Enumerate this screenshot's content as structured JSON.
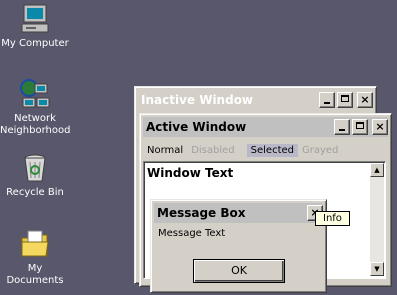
{
  "desktop": {
    "icons": [
      {
        "label": "My Computer"
      },
      {
        "label": "Network Neighborhood"
      },
      {
        "label": "Recycle Bin"
      },
      {
        "label": "My Documents"
      }
    ]
  },
  "inactive_window": {
    "title": "Inactive Window"
  },
  "active_window": {
    "title": "Active Window",
    "menu": [
      "Normal",
      "Disabled",
      "Selected",
      "Grayed"
    ],
    "body_text": "Window Text"
  },
  "message_box": {
    "title": "Message Box",
    "text": "Message Text",
    "ok_label": "OK"
  },
  "tooltip": {
    "text": "Info"
  },
  "colors": {
    "desktop": "#59576c",
    "face": "#d4d0c8",
    "active_title": "#c0c0c0",
    "inactive_title": "#d4d0c8",
    "selected_menu": "#b8b8c8",
    "tooltip_bg": "#ffffe1"
  }
}
